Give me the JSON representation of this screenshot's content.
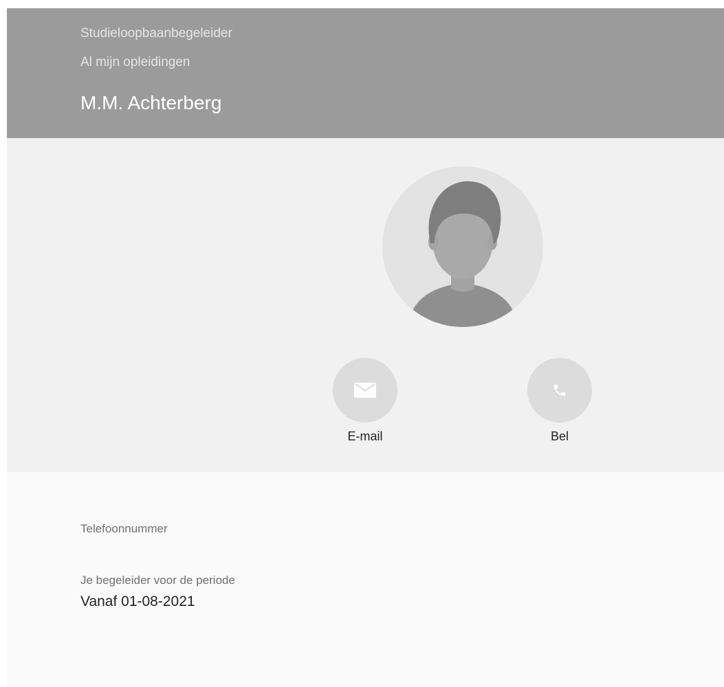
{
  "header": {
    "role": "Studieloopbaanbegeleider",
    "context": "Al mijn opleidingen",
    "name": "M.M. Achterberg",
    "background_color": "#9b9b9b"
  },
  "profile": {
    "avatar_icon": "person-silhouette-icon",
    "actions": [
      {
        "label": "E-mail",
        "icon": "mail-icon"
      },
      {
        "label": "Bel",
        "icon": "phone-icon"
      }
    ]
  },
  "details": {
    "phone_label": "Telefoonnummer",
    "period_label": "Je begeleider voor de periode",
    "period_value": "Vanaf 01-08-2021"
  }
}
